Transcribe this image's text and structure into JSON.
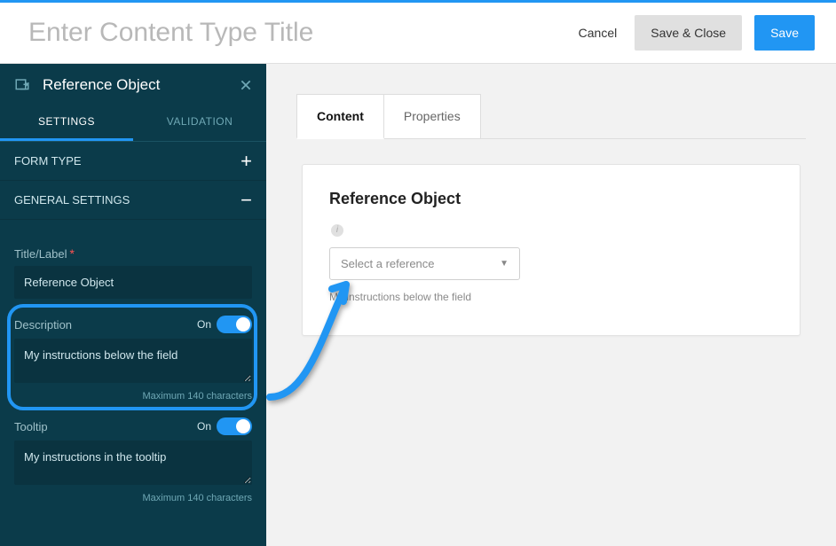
{
  "header": {
    "title_placeholder": "Enter Content Type Title",
    "cancel": "Cancel",
    "save_close": "Save & Close",
    "save": "Save"
  },
  "sidebar": {
    "title": "Reference Object",
    "tabs": {
      "settings": "SETTINGS",
      "validation": "VALIDATION"
    },
    "sections": {
      "form_type": "FORM TYPE",
      "general": "GENERAL SETTINGS"
    },
    "fields": {
      "title_label": "Title/Label",
      "title_value": "Reference Object",
      "description_label": "Description",
      "description_value": "My instructions below the field",
      "tooltip_label": "Tooltip",
      "tooltip_value": "My instructions in the tooltip",
      "max_hint": "Maximum 140 characters",
      "on_text": "On"
    }
  },
  "main": {
    "tabs": {
      "content": "Content",
      "properties": "Properties"
    },
    "card": {
      "title": "Reference Object",
      "select_placeholder": "Select a reference",
      "helper": "My instructions below the field"
    }
  }
}
